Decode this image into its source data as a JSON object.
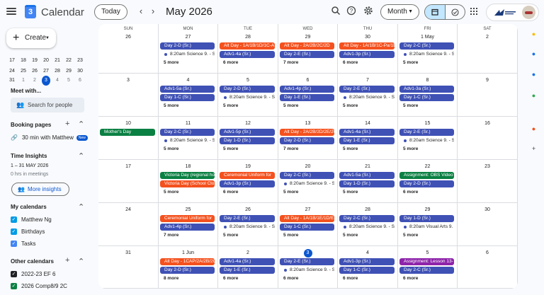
{
  "header": {
    "app_title": "Calendar",
    "logo_text": "3",
    "today_label": "Today",
    "prev_icon": "chevron-left-icon",
    "next_icon": "chevron-right-icon",
    "month_title": "May 2026",
    "view_label": "Month",
    "icons": [
      "search-icon",
      "help-icon",
      "settings-icon",
      "calendar-view-icon",
      "tasks-view-icon",
      "apps-grid-icon"
    ]
  },
  "sidebar": {
    "create_label": "Create",
    "mini_calendar": [
      [
        "17",
        "18",
        "19",
        "20",
        "21",
        "22",
        "23"
      ],
      [
        "24",
        "25",
        "26",
        "27",
        "28",
        "29",
        "30"
      ],
      [
        "31",
        "1",
        "2",
        "3",
        "4",
        "5",
        "6"
      ]
    ],
    "meet_with": "Meet with...",
    "search_people": "Search for people",
    "booking_pages": "Booking pages",
    "booking_item": "30 min with Matthew",
    "new_badge": "New",
    "time_insights": "Time Insights",
    "insights_range": "1 – 31 MAY 2026",
    "insights_hours": "0 hrs in meetings",
    "more_insights": "More insights",
    "my_calendars_heading": "My calendars",
    "my_calendars": [
      {
        "label": "Matthew Ng",
        "color": "#039be5"
      },
      {
        "label": "Birthdays",
        "color": "#039be5"
      },
      {
        "label": "Tasks",
        "color": "#4285f4"
      }
    ],
    "other_calendars_heading": "Other calendars",
    "other_calendars": [
      {
        "label": "2022-23 EF 6",
        "color": "#202124"
      },
      {
        "label": "2026 Comp8/9 2C",
        "color": "#0b8043"
      }
    ]
  },
  "grid": {
    "weekdays": [
      "SUN",
      "MON",
      "TUE",
      "WED",
      "THU",
      "FRI",
      "SAT"
    ],
    "weeks": [
      {
        "days": [
          {
            "num": "26",
            "events": [],
            "more": ""
          },
          {
            "num": "27",
            "events": [
              {
                "t": "Day 2-D (Sr.)",
                "c": "blue"
              },
              {
                "t": "8:20am Science 9. - SC",
                "c": "dot"
              }
            ],
            "more": "5 more"
          },
          {
            "num": "28",
            "events": [
              {
                "t": "Alt Day - 1A/1B/1D/1C-A",
                "c": "orange"
              },
              {
                "t": "Adv1-4a (Sr.)",
                "c": "blue"
              }
            ],
            "more": "6 more"
          },
          {
            "num": "29",
            "events": [
              {
                "t": "Alt Day - 2A/2B/2C/2D",
                "c": "orange"
              },
              {
                "t": "Day 2-E (Sr.)",
                "c": "blue"
              }
            ],
            "more": "7 more"
          },
          {
            "num": "30",
            "events": [
              {
                "t": "Alt Day - 1A/1B/1C-Pa/1E",
                "c": "orange"
              },
              {
                "t": "Adv1-3p (Sr.)",
                "c": "blue"
              }
            ],
            "more": "6 more"
          },
          {
            "num": "1 May",
            "events": [
              {
                "t": "Day 2-C (Sr.)",
                "c": "blue"
              },
              {
                "t": "8:20am Science 9. - SC",
                "c": "dot"
              }
            ],
            "more": "5 more"
          },
          {
            "num": "2",
            "events": [],
            "more": ""
          }
        ]
      },
      {
        "days": [
          {
            "num": "3",
            "events": [],
            "more": ""
          },
          {
            "num": "4",
            "events": [
              {
                "t": "Adv1-5a (Sr.)",
                "c": "blue"
              },
              {
                "t": "Day 1-C (Sr.)",
                "c": "blue"
              }
            ],
            "more": "5 more"
          },
          {
            "num": "5",
            "events": [
              {
                "t": "Day 2-D (Sr.)",
                "c": "blue"
              },
              {
                "t": "8:20am Science 9. - SC",
                "c": "dot"
              }
            ],
            "more": "5 more"
          },
          {
            "num": "6",
            "events": [
              {
                "t": "Adv1-4p (Sr.)",
                "c": "blue"
              },
              {
                "t": "Day 1-E (Sr.)",
                "c": "blue"
              }
            ],
            "more": "5 more"
          },
          {
            "num": "7",
            "events": [
              {
                "t": "Day 2-E (Sr.)",
                "c": "blue"
              },
              {
                "t": "8:20am Science 9. - SC",
                "c": "dot"
              }
            ],
            "more": "5 more"
          },
          {
            "num": "8",
            "events": [
              {
                "t": "Adv1-3a (Sr.)",
                "c": "blue"
              },
              {
                "t": "Day 1-C (Sr.)",
                "c": "blue"
              }
            ],
            "more": "5 more"
          },
          {
            "num": "9",
            "events": [],
            "more": ""
          }
        ]
      },
      {
        "days": [
          {
            "num": "10",
            "events": [
              {
                "t": "Mother's Day",
                "c": "green"
              }
            ],
            "more": ""
          },
          {
            "num": "11",
            "events": [
              {
                "t": "Day 2-C (Sr.)",
                "c": "blue"
              },
              {
                "t": "8:20am Science 9. - SC",
                "c": "dot"
              }
            ],
            "more": "5 more"
          },
          {
            "num": "12",
            "events": [
              {
                "t": "Adv1-5p (Sr.)",
                "c": "blue"
              },
              {
                "t": "Day 1-D (Sr.)",
                "c": "blue"
              }
            ],
            "more": "5 more"
          },
          {
            "num": "13",
            "events": [
              {
                "t": "Alt Day - 2A/2B/2D/2E/2C",
                "c": "orange"
              },
              {
                "t": "Day 2-D (Sr.)",
                "c": "blue"
              }
            ],
            "more": "7 more"
          },
          {
            "num": "14",
            "events": [
              {
                "t": "Adv1-4a (Sr.)",
                "c": "blue"
              },
              {
                "t": "Day 1-E (Sr.)",
                "c": "blue"
              }
            ],
            "more": "5 more"
          },
          {
            "num": "15",
            "events": [
              {
                "t": "Day 2-E (Sr.)",
                "c": "blue"
              },
              {
                "t": "8:20am Science 9. - SC",
                "c": "dot"
              }
            ],
            "more": "5 more"
          },
          {
            "num": "16",
            "events": [],
            "more": ""
          }
        ]
      },
      {
        "days": [
          {
            "num": "17",
            "events": [],
            "more": ""
          },
          {
            "num": "18",
            "events": [
              {
                "t": "Victoria Day (regional ho",
                "c": "green"
              },
              {
                "t": "Victoria Day (School Clo",
                "c": "orange"
              }
            ],
            "more": "5 more"
          },
          {
            "num": "19",
            "events": [
              {
                "t": "Ceremonial Uniform for ",
                "c": "orange"
              },
              {
                "t": "Adv1-3p (Sr.)",
                "c": "blue"
              }
            ],
            "more": "6 more"
          },
          {
            "num": "20",
            "events": [
              {
                "t": "Day 2-C (Sr.)",
                "c": "blue"
              },
              {
                "t": "8:20am Science 9. - SC",
                "c": "dot"
              }
            ],
            "more": "5 more"
          },
          {
            "num": "21",
            "events": [
              {
                "t": "Adv1-5a (Sr.)",
                "c": "blue"
              },
              {
                "t": "Day 1-D (Sr.)",
                "c": "blue"
              }
            ],
            "more": "5 more"
          },
          {
            "num": "22",
            "events": [
              {
                "t": "Assignment: OBS Video",
                "c": "green"
              },
              {
                "t": "Day 2-D (Sr.)",
                "c": "blue"
              }
            ],
            "more": "6 more"
          },
          {
            "num": "23",
            "events": [],
            "more": ""
          }
        ]
      },
      {
        "days": [
          {
            "num": "24",
            "events": [],
            "more": ""
          },
          {
            "num": "25",
            "events": [
              {
                "t": "Ceremonial Uniform for",
                "c": "orange"
              },
              {
                "t": "Adv1-4p (Sr.)",
                "c": "blue"
              }
            ],
            "more": "7 more"
          },
          {
            "num": "26",
            "events": [
              {
                "t": "Day 2-E (Sr.)",
                "c": "blue"
              },
              {
                "t": "8:20am Science 9. - SC",
                "c": "dot"
              }
            ],
            "more": "5 more"
          },
          {
            "num": "27",
            "events": [
              {
                "t": "Alt Day - 1A/1B/1E/1D/Ea",
                "c": "orange"
              },
              {
                "t": "Day 1-C (Sr.)",
                "c": "blue"
              }
            ],
            "more": "5 more"
          },
          {
            "num": "28",
            "events": [
              {
                "t": "Day 2-C (Sr.)",
                "c": "blue"
              },
              {
                "t": "8:20am Science 9. - SC",
                "c": "dot"
              }
            ],
            "more": "5 more"
          },
          {
            "num": "29",
            "events": [
              {
                "t": "Day 1-D (Sr.)",
                "c": "blue"
              },
              {
                "t": "8:20am Visual Arts 9. -",
                "c": "dot"
              }
            ],
            "more": "5 more"
          },
          {
            "num": "30",
            "events": [],
            "more": ""
          }
        ]
      },
      {
        "days": [
          {
            "num": "31",
            "events": [],
            "more": ""
          },
          {
            "num": "1 Jun",
            "events": [
              {
                "t": "Alt Day - 1CAP/2A/2B/2C",
                "c": "orange"
              },
              {
                "t": "Day 2-D (Sr.)",
                "c": "blue"
              }
            ],
            "more": "8 more"
          },
          {
            "num": "2",
            "events": [
              {
                "t": "Adv1-4a (Sr.)",
                "c": "blue"
              },
              {
                "t": "Day 1-E (Sr.)",
                "c": "blue"
              }
            ],
            "more": "6 more"
          },
          {
            "num": "3",
            "events": [
              {
                "t": "Day 2-E (Sr.)",
                "c": "blue"
              },
              {
                "t": "8:20am Science 9. - SC",
                "c": "dot"
              }
            ],
            "more": "6 more",
            "today": true
          },
          {
            "num": "4",
            "events": [
              {
                "t": "Adv1-3p (Sr.)",
                "c": "blue"
              },
              {
                "t": "Day 1-C (Sr.)",
                "c": "blue"
              }
            ],
            "more": "6 more"
          },
          {
            "num": "5",
            "events": [
              {
                "t": "Assignment: Lesson 13-",
                "c": "purple"
              },
              {
                "t": "Day 2-C (Sr.)",
                "c": "blue"
              }
            ],
            "more": "6 more"
          },
          {
            "num": "6",
            "events": [],
            "more": ""
          }
        ]
      }
    ]
  },
  "colors": {
    "blue": "#3f51b5",
    "orange": "#f4511e",
    "green": "#0b8043",
    "purple": "#8e24aa",
    "accent": "#0b57d0"
  },
  "right_rail": [
    "keep-icon",
    "tasks-icon",
    "contacts-icon",
    "maps-icon",
    "addon-icon",
    "add-icon"
  ]
}
